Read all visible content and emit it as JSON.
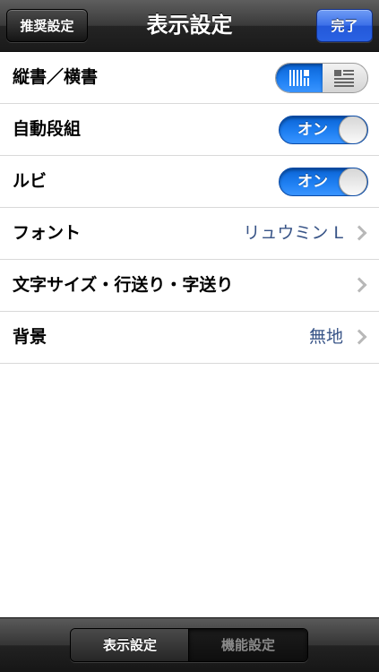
{
  "navbar": {
    "title": "表示設定",
    "left_button": "推奨設定",
    "right_button": "完了"
  },
  "rows": [
    {
      "label": "縦書／横書",
      "control": "segmented-toggle",
      "selected": "vertical"
    },
    {
      "label": "自動段組",
      "control": "switch",
      "state": "オン"
    },
    {
      "label": "ルビ",
      "control": "switch",
      "state": "オン"
    },
    {
      "label": "フォント",
      "value": "リュウミン L",
      "control": "disclosure"
    },
    {
      "label": "文字サイズ・行送り・字送り",
      "control": "disclosure"
    },
    {
      "label": "背景",
      "value": "無地",
      "control": "disclosure"
    }
  ],
  "toolbar": {
    "segments": [
      "表示設定",
      "機能設定"
    ],
    "active_segment": "表示設定"
  },
  "colors": {
    "accent_blue": "#1e7ff2",
    "done_button_blue": "#3b6fe8",
    "value_text": "#385487"
  },
  "icons": {
    "vertical_layout": "vertical-text-icon",
    "horizontal_layout": "horizontal-text-icon",
    "disclosure": "chevron-right-icon"
  }
}
